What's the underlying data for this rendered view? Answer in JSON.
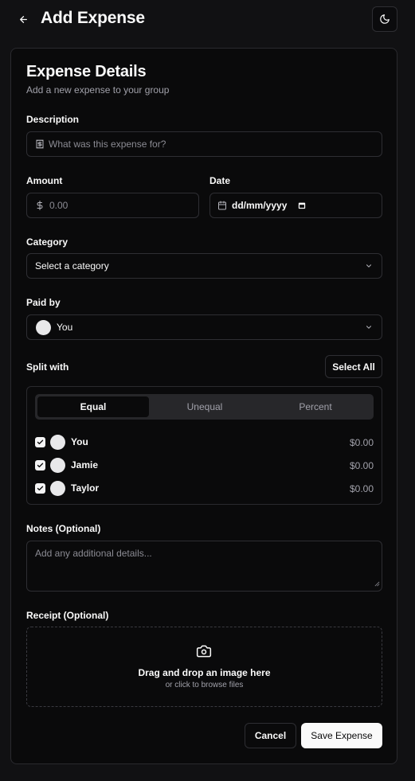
{
  "header": {
    "title": "Add Expense",
    "back_icon": "arrow-left-icon",
    "theme_icon": "moon-icon"
  },
  "card": {
    "title": "Expense Details",
    "subtitle": "Add a new expense to your group"
  },
  "description": {
    "label": "Description",
    "placeholder": "What was this expense for?",
    "icon": "receipt-icon"
  },
  "amount": {
    "label": "Amount",
    "placeholder": "0.00",
    "icon": "dollar-icon"
  },
  "date": {
    "label": "Date",
    "placeholder": "dd/mm/yyyy",
    "icon": "calendar-icon"
  },
  "category": {
    "label": "Category",
    "value": "Select a category"
  },
  "paid_by": {
    "label": "Paid by",
    "value": "You"
  },
  "split": {
    "label": "Split with",
    "select_all_label": "Select All",
    "tabs": [
      {
        "label": "Equal",
        "active": true
      },
      {
        "label": "Unequal",
        "active": false
      },
      {
        "label": "Percent",
        "active": false
      }
    ],
    "people": [
      {
        "name": "You",
        "amount": "$0.00",
        "checked": true
      },
      {
        "name": "Jamie",
        "amount": "$0.00",
        "checked": true
      },
      {
        "name": "Taylor",
        "amount": "$0.00",
        "checked": true
      }
    ]
  },
  "notes": {
    "label": "Notes (Optional)",
    "placeholder": "Add any additional details..."
  },
  "receipt": {
    "label": "Receipt (Optional)",
    "title": "Drag and drop an image here",
    "subtitle": "or click to browse files",
    "icon": "camera-icon"
  },
  "actions": {
    "cancel_label": "Cancel",
    "save_label": "Save Expense"
  },
  "colors": {
    "background": "#111113",
    "card": "#0a0a0b",
    "border": "#2e2e33",
    "muted": "#a1a1aa",
    "primary": "#fafafa"
  }
}
